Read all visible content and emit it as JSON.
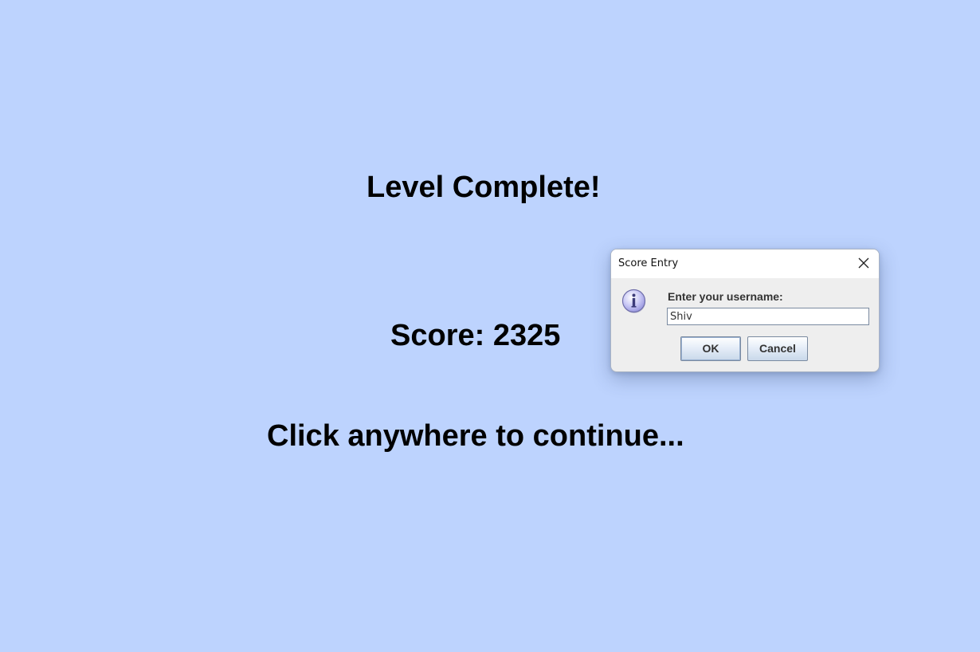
{
  "game": {
    "title": "Level Complete!",
    "score_text": "Score: 2325",
    "continue_text": "Click anywhere to continue..."
  },
  "dialog": {
    "title": "Score Entry",
    "close_icon": "close-icon",
    "info_icon": "info-icon",
    "prompt": "Enter your username:",
    "input_value": "Shiv",
    "ok_label": "OK",
    "cancel_label": "Cancel"
  },
  "colors": {
    "background": "#bdd3fe",
    "dialog_background": "#eeeeee",
    "icon_fill": "#c9c8f5"
  }
}
